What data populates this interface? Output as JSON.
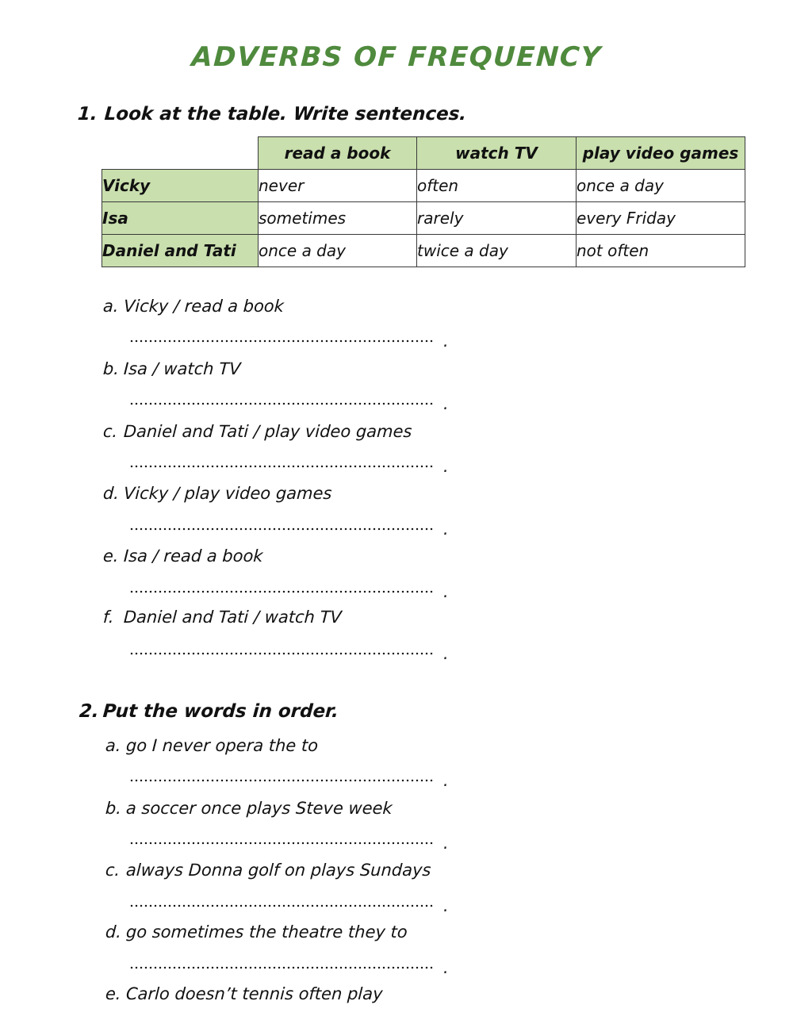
{
  "title": "ADVERBS OF FREQUENCY",
  "colors": {
    "title_green": "#4f8a3d",
    "table_green": "#c9dfae",
    "border": "#3a3a3a",
    "text": "#111111"
  },
  "exercise1": {
    "number": "1.",
    "heading": "Look at the table. Write sentences.",
    "table": {
      "corner": "",
      "columns": [
        "read a book",
        "watch TV",
        "play video games"
      ],
      "rows": [
        {
          "label": "Vicky",
          "cells": [
            "never",
            "often",
            "once a day"
          ]
        },
        {
          "label": "Isa",
          "cells": [
            "sometimes",
            "rarely",
            "every Friday"
          ]
        },
        {
          "label": "Daniel and Tati",
          "cells": [
            "once a day",
            "twice a day",
            "not often"
          ]
        }
      ]
    },
    "items": [
      {
        "letter": "a.",
        "text": "Vicky / read a book",
        "answer": "",
        "end_mark": "."
      },
      {
        "letter": "b.",
        "text": "Isa / watch TV",
        "answer": "",
        "end_mark": "."
      },
      {
        "letter": "c.",
        "text": "Daniel and Tati / play video games",
        "answer": "",
        "end_mark": "."
      },
      {
        "letter": "d.",
        "text": "Vicky / play video games",
        "answer": "",
        "end_mark": "."
      },
      {
        "letter": "e.",
        "text": "Isa / read a book",
        "answer": "",
        "end_mark": "."
      },
      {
        "letter": "f.",
        "text": "Daniel and Tati / watch TV",
        "answer": "",
        "end_mark": "."
      }
    ]
  },
  "exercise2": {
    "number": "2.",
    "heading": "Put the words in order.",
    "items": [
      {
        "letter": "a.",
        "text": "go I never opera the to",
        "answer": "",
        "end_mark": "."
      },
      {
        "letter": "b.",
        "text": "a soccer once plays Steve week",
        "answer": "",
        "end_mark": "."
      },
      {
        "letter": "c.",
        "text": "always Donna golf on plays Sundays",
        "answer": "",
        "end_mark": "."
      },
      {
        "letter": "d.",
        "text": "go sometimes the theatre they to",
        "answer": "",
        "end_mark": "."
      },
      {
        "letter": "e.",
        "text": "Carlo doesn’t tennis often play",
        "answer": "",
        "end_mark": ""
      }
    ]
  }
}
